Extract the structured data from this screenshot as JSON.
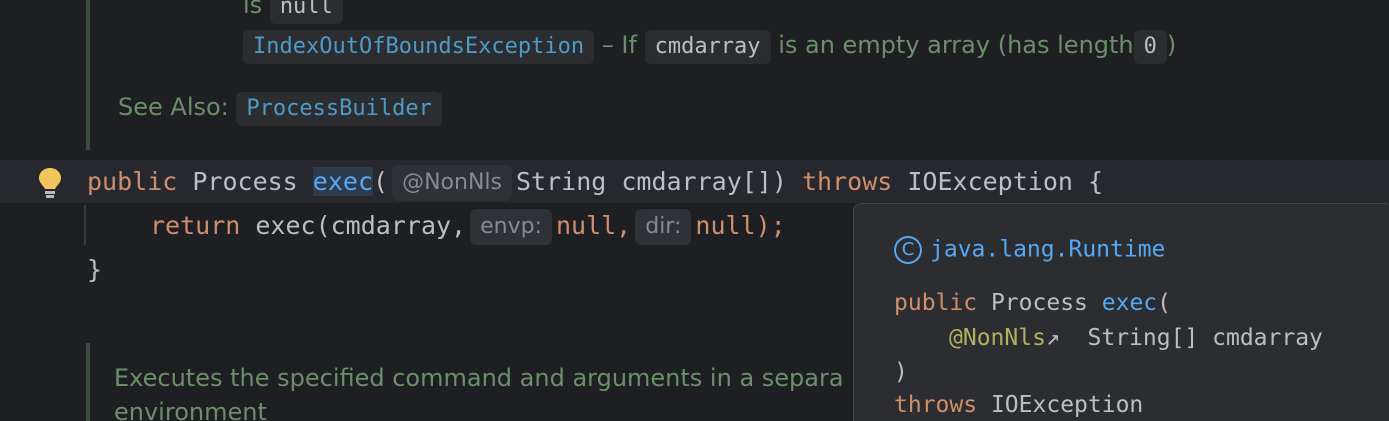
{
  "doc_top": {
    "is_text": "is",
    "null_chip": "null",
    "exception_link": "IndexOutOfBoundsException",
    "if_text": "– If",
    "cmdarray_chip": "cmdarray",
    "empty_text": "is an empty array (has length",
    "zero_chip": "0",
    "close_paren": ")",
    "see_also_label": "See Also:",
    "see_also_link": "ProcessBuilder"
  },
  "code": {
    "line1": {
      "kw_public": "public",
      "type_process": "Process",
      "method_exec": "exec",
      "open_paren": "(",
      "hint_nonnls": "@NonNls",
      "rest": "String cmdarray[])",
      "kw_throws": "throws",
      "exc": "IOException {"
    },
    "line2": {
      "kw_return": "return",
      "call": "exec(cmdarray,",
      "hint_envp": "envp:",
      "null1": "null,",
      "hint_dir": "dir:",
      "null2": "null);"
    },
    "line3": "}"
  },
  "doc_bottom": {
    "line1": "Executes the specified command and arguments in a separa",
    "line2": "environment"
  },
  "popup": {
    "class_icon": "C",
    "package": "java.lang.Runtime",
    "sig_kw_public": "public",
    "sig_type": "Process",
    "sig_method": "exec",
    "sig_open": "(",
    "sig_annotation": "@NonNls",
    "sig_arrow": "↗",
    "sig_param": "String[] cmdarray",
    "sig_close": ")",
    "sig_kw_throws": "throws",
    "sig_exc": "IOException"
  },
  "icons": {
    "bulb": "lightbulb-icon",
    "class": "class-icon",
    "external": "external-link-icon"
  },
  "colors": {
    "background": "#1e1f22",
    "keyword": "#cf8e6d",
    "method": "#56a8f5",
    "doc_text": "#6a8f6a",
    "link": "#4e9bc7",
    "annotation": "#b3ae60",
    "bulb": "#f2c55c"
  }
}
